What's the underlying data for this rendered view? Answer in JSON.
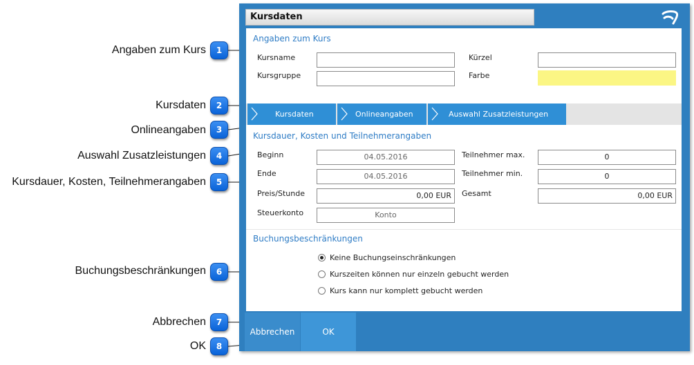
{
  "dialog": {
    "title": "Kursdaten",
    "logo_icon": "aeon-logo-icon"
  },
  "course_info": {
    "section_title": "Angaben zum Kurs",
    "kursname_label": "Kursname",
    "kursname_value": "",
    "kuerzel_label": "Kürzel",
    "kuerzel_value": "",
    "kursgruppe_label": "Kursgruppe",
    "kursgruppe_value": "",
    "farbe_label": "Farbe",
    "farbe_color": "#fbf684"
  },
  "tabs": [
    {
      "label": "Kursdaten"
    },
    {
      "label": "Onlineangaben"
    },
    {
      "label": "Auswahl Zusatzleistungen"
    }
  ],
  "details": {
    "section_title": "Kursdauer, Kosten und Teilnehmerangaben",
    "beginn_label": "Beginn",
    "beginn_value": "04.05.2016",
    "ende_label": "Ende",
    "ende_value": "04.05.2016",
    "preis_label": "Preis/Stunde",
    "preis_value": "0,00 EUR",
    "steuer_label": "Steuerkonto",
    "steuer_value": "Konto",
    "tn_max_label": "Teilnehmer max.",
    "tn_max_value": "0",
    "tn_min_label": "Teilnehmer min.",
    "tn_min_value": "0",
    "gesamt_label": "Gesamt",
    "gesamt_value": "0,00 EUR"
  },
  "restrictions": {
    "section_title": "Buchungsbeschränkungen",
    "options": [
      {
        "label": "Keine Buchungseinschränkungen",
        "selected": true
      },
      {
        "label": "Kurszeiten können nur einzeln gebucht werden",
        "selected": false
      },
      {
        "label": "Kurs kann nur komplett gebucht werden",
        "selected": false
      }
    ]
  },
  "buttons": {
    "cancel_label": "Abbrechen",
    "ok_label": "OK"
  },
  "callouts": [
    {
      "number": "1",
      "label": "Angaben zum Kurs"
    },
    {
      "number": "2",
      "label": "Kursdaten"
    },
    {
      "number": "3",
      "label": "Onlineangaben"
    },
    {
      "number": "4",
      "label": "Auswahl Zusatzleistungen"
    },
    {
      "number": "5",
      "label": "Kursdauer, Kosten, Teilnehmerangaben"
    },
    {
      "number": "6",
      "label": "Buchungsbeschränkungen"
    },
    {
      "number": "7",
      "label": "Abbrechen"
    },
    {
      "number": "8",
      "label": "OK"
    }
  ],
  "colors": {
    "frame": "#2f7fbf",
    "tab": "#2f8fd6",
    "accent_text": "#2e7cc5",
    "badge": "#1a78e8"
  }
}
